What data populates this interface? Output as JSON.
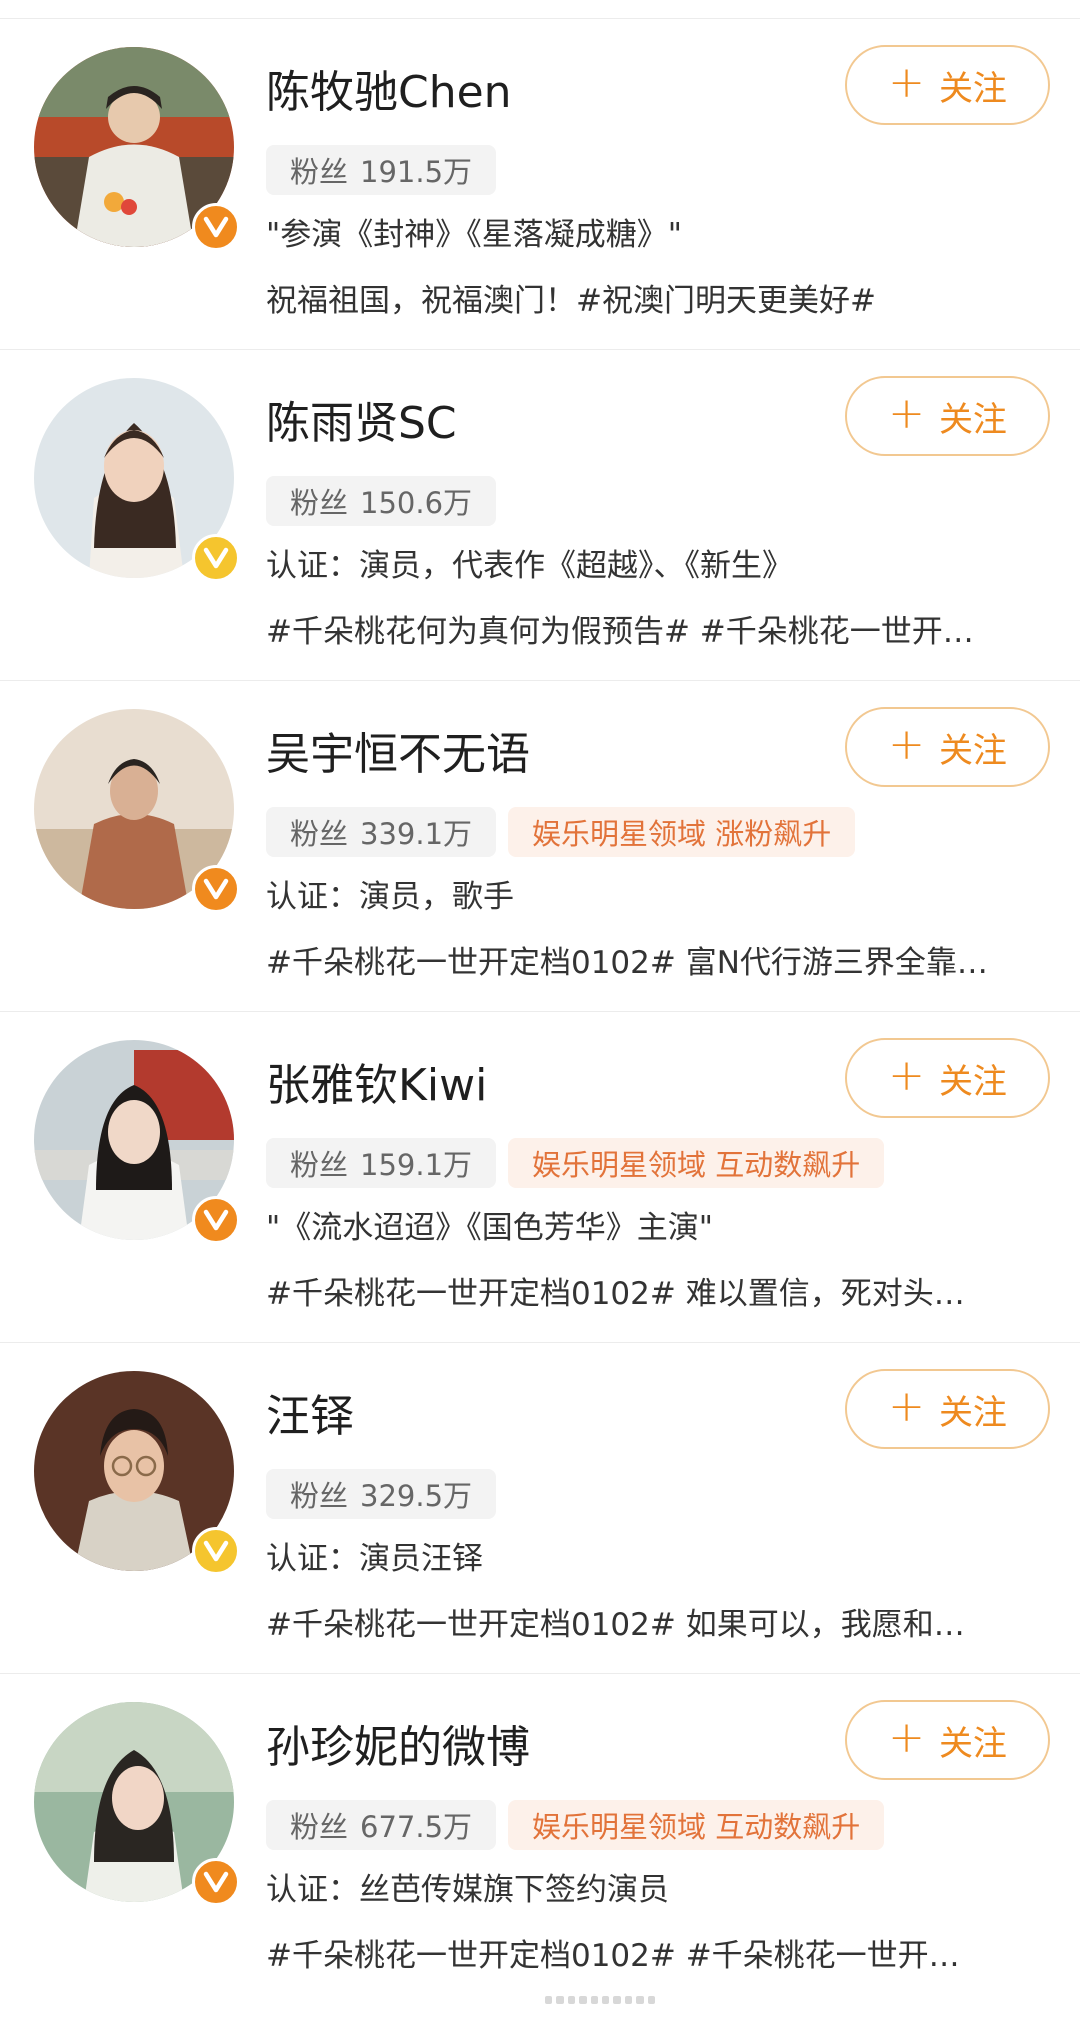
{
  "follow_label": "关注",
  "fans_label": "粉丝",
  "colors": {
    "accent": "#ee8a1f",
    "hot_text": "#e2733a",
    "badge_orange": "#f08a1e",
    "badge_gold": "#f5c52e"
  },
  "users": [
    {
      "name": "陈牧驰Chen",
      "fans": "191.5万",
      "hot": "",
      "badge": "orange-v-icon",
      "desc": "\"参演《封神》《星落凝成糖》\"",
      "post": "祝福祖国，祝福澳门！#祝澳门明天更美好#"
    },
    {
      "name": "陈雨贤SC",
      "fans": "150.6万",
      "hot": "",
      "badge": "gold-v-icon",
      "desc": "认证：演员，代表作《超越》、《新生》",
      "post": "#千朵桃花何为真何为假预告# #千朵桃花一世开…"
    },
    {
      "name": "吴宇恒不无语",
      "fans": "339.1万",
      "hot": "娱乐明星领域 涨粉飙升",
      "badge": "orange-v-icon",
      "desc": "认证：演员，歌手",
      "post": "#千朵桃花一世开定档0102# 富N代行游三界全靠…"
    },
    {
      "name": "张雅钦Kiwi",
      "fans": "159.1万",
      "hot": "娱乐明星领域 互动数飙升",
      "badge": "orange-v-icon",
      "desc": "\"《流水迢迢》《国色芳华》主演\"",
      "post": "#千朵桃花一世开定档0102# 难以置信，死对头…"
    },
    {
      "name": "汪铎",
      "fans": "329.5万",
      "hot": "",
      "badge": "gold-v-icon",
      "desc": "认证：演员汪铎",
      "post": "#千朵桃花一世开定档0102# 如果可以，我愿和…"
    },
    {
      "name": "孙珍妮的微博",
      "fans": "677.5万",
      "hot": "娱乐明星领域 互动数飙升",
      "badge": "orange-v-icon",
      "desc": "认证：丝芭传媒旗下签约演员",
      "post": "#千朵桃花一世开定档0102# #千朵桃花一世开…"
    }
  ]
}
